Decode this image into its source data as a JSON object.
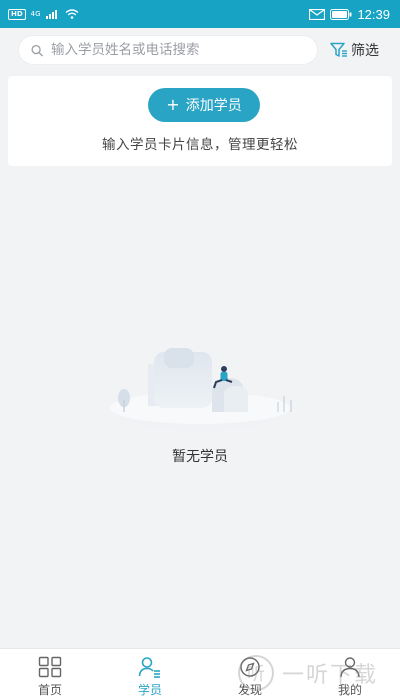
{
  "status_bar": {
    "hd_badge": "HD",
    "network": "4G",
    "time": "12:39"
  },
  "search": {
    "placeholder": "输入学员姓名或电话搜索",
    "filter_label": "筛选"
  },
  "add_card": {
    "button_label": "添加学员",
    "hint": "输入学员卡片信息，管理更轻松"
  },
  "empty_state": {
    "text": "暂无学员"
  },
  "tabs": [
    {
      "label": "首页",
      "icon": "grid-icon",
      "active": false
    },
    {
      "label": "学员",
      "icon": "students-icon",
      "active": true
    },
    {
      "label": "发现",
      "icon": "discover-icon",
      "active": false
    },
    {
      "label": "我的",
      "icon": "profile-icon",
      "active": false
    }
  ],
  "watermark": {
    "logo_text": "听",
    "text": "一听下载"
  },
  "colors": {
    "accent": "#2aa4c5",
    "status_bar": "#17a3c4",
    "background": "#f2f3f5"
  }
}
